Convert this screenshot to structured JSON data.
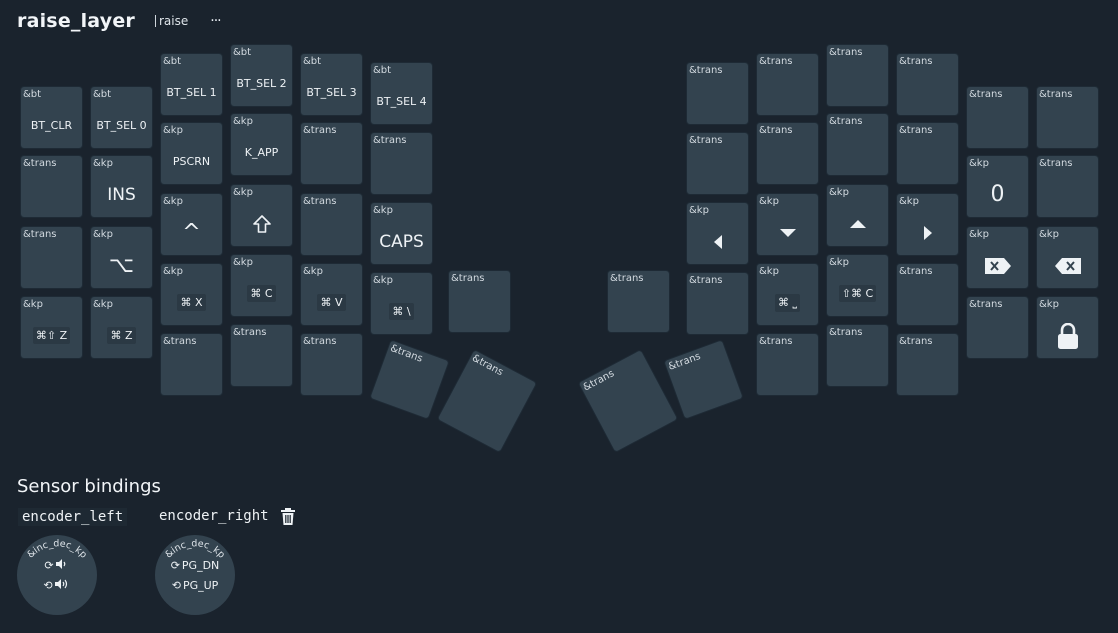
{
  "header": {
    "title": "raise_layer",
    "tag": "raise",
    "more": "···"
  },
  "keys": [
    {
      "hdr": "&bt",
      "label": "BT_CLR",
      "style": "sm"
    },
    {
      "hdr": "&bt",
      "label": "BT_SEL 0",
      "style": "sm"
    },
    {
      "hdr": "&bt",
      "label": "BT_SEL 1",
      "style": "sm"
    },
    {
      "hdr": "&bt",
      "label": "BT_SEL 2",
      "style": "sm"
    },
    {
      "hdr": "&bt",
      "label": "BT_SEL 3",
      "style": "sm"
    },
    {
      "hdr": "&bt",
      "label": "BT_SEL 4",
      "style": "sm"
    },
    {
      "hdr": "&trans",
      "label": ""
    },
    {
      "hdr": "&trans",
      "label": ""
    },
    {
      "hdr": "&trans",
      "label": ""
    },
    {
      "hdr": "&trans",
      "label": ""
    },
    {
      "hdr": "&trans",
      "label": ""
    },
    {
      "hdr": "&trans",
      "label": ""
    },
    {
      "hdr": "&trans",
      "label": ""
    },
    {
      "hdr": "&kp",
      "label": "INS",
      "style": "lg"
    },
    {
      "hdr": "&kp",
      "label": "PSCRN",
      "style": "sm"
    },
    {
      "hdr": "&kp",
      "label": "K_APP",
      "style": "sm"
    },
    {
      "hdr": "&trans",
      "label": ""
    },
    {
      "hdr": "&trans",
      "label": ""
    },
    {
      "hdr": "&trans",
      "label": ""
    },
    {
      "hdr": "&trans",
      "label": ""
    },
    {
      "hdr": "&trans",
      "label": ""
    },
    {
      "hdr": "&trans",
      "label": ""
    },
    {
      "hdr": "&kp",
      "label": "0",
      "style": "xl"
    },
    {
      "hdr": "&trans",
      "label": ""
    },
    {
      "hdr": "&trans",
      "label": ""
    },
    {
      "hdr": "&kp",
      "label": "⌥",
      "style": "xl"
    },
    {
      "hdr": "&kp",
      "label": "^",
      "style": "xl"
    },
    {
      "hdr": "&kp",
      "icon": "shift-icon"
    },
    {
      "hdr": "&trans",
      "label": ""
    },
    {
      "hdr": "&kp",
      "label": "CAPS",
      "style": "lg"
    },
    {
      "hdr": "&kp",
      "icon": "arrow-left-icon"
    },
    {
      "hdr": "&kp",
      "icon": "arrow-down-icon"
    },
    {
      "hdr": "&kp",
      "icon": "arrow-up-icon"
    },
    {
      "hdr": "&kp",
      "icon": "arrow-right-icon"
    },
    {
      "hdr": "&kp",
      "icon": "delete-forward-icon"
    },
    {
      "hdr": "&kp",
      "icon": "backspace-icon"
    },
    {
      "hdr": "&kp",
      "label": "⌘⇧ Z",
      "style": "mod"
    },
    {
      "hdr": "&kp",
      "label": "⌘ Z",
      "style": "mod"
    },
    {
      "hdr": "&kp",
      "label": "⌘ X",
      "style": "mod"
    },
    {
      "hdr": "&kp",
      "label": "⌘ C",
      "style": "mod"
    },
    {
      "hdr": "&kp",
      "label": "⌘ V",
      "style": "mod"
    },
    {
      "hdr": "&kp",
      "label": "⌘ \\",
      "style": "mod"
    },
    {
      "hdr": "&trans",
      "label": ""
    },
    {
      "hdr": "&trans",
      "label": ""
    },
    {
      "hdr": "&trans",
      "label": ""
    },
    {
      "hdr": "&kp",
      "label": "⌘ ⎵",
      "style": "mod"
    },
    {
      "hdr": "&kp",
      "label": "⇧⌘ C",
      "style": "mod"
    },
    {
      "hdr": "&trans",
      "label": ""
    },
    {
      "hdr": "&trans",
      "label": ""
    },
    {
      "hdr": "&kp",
      "icon": "lock-icon"
    },
    {
      "hdr": "&trans",
      "label": ""
    },
    {
      "hdr": "&trans",
      "label": ""
    },
    {
      "hdr": "&trans",
      "label": ""
    },
    {
      "hdr": "&trans",
      "label": ""
    },
    {
      "hdr": "&trans",
      "label": ""
    },
    {
      "hdr": "&trans",
      "label": ""
    },
    {
      "hdr": "&trans",
      "label": ""
    },
    {
      "hdr": "&trans",
      "label": ""
    },
    {
      "hdr": "&trans",
      "label": ""
    },
    {
      "hdr": "&trans",
      "label": ""
    }
  ],
  "sensors": {
    "title": "Sensor bindings",
    "encoders": [
      {
        "name": "encoder_left",
        "binding": "&inc_dec_kp",
        "cw_icon": "volume-down-icon",
        "ccw_icon": "volume-up-icon",
        "cw": "",
        "ccw": ""
      },
      {
        "name": "encoder_right",
        "binding": "&inc_dec_kp",
        "cw": "PG_DN",
        "ccw": "PG_UP"
      }
    ]
  }
}
